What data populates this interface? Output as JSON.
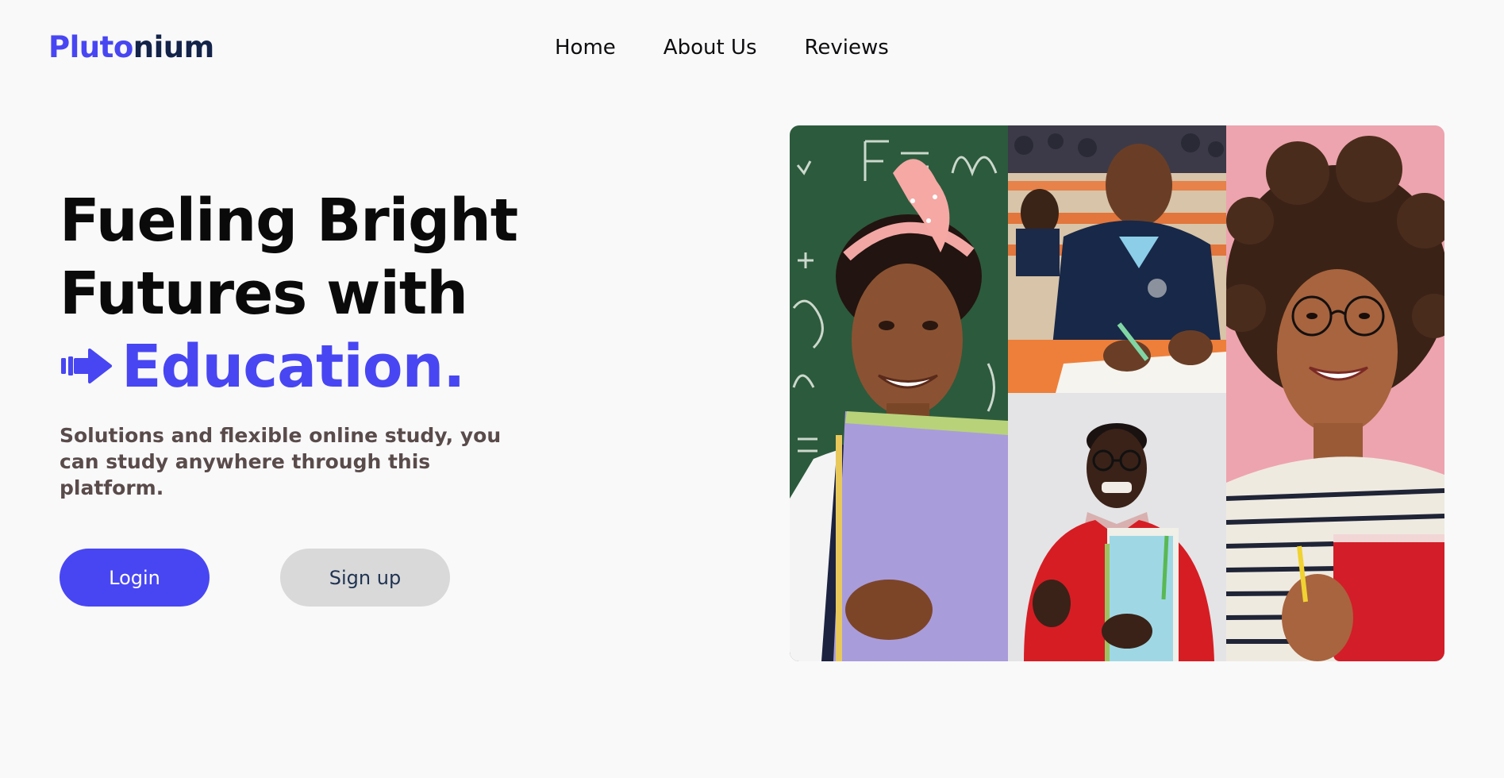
{
  "header": {
    "logo_part1": "Pluto",
    "logo_part2": "nium",
    "nav": [
      {
        "label": "Home"
      },
      {
        "label": "About Us"
      },
      {
        "label": "Reviews"
      }
    ]
  },
  "hero": {
    "headline_line1": "Fueling Bright",
    "headline_line2": "Futures with",
    "headline_accent": "Education.",
    "subtext": "Solutions and flexible online study, you can study anywhere through this platform.",
    "login_label": "Login",
    "signup_label": "Sign up",
    "accent_icon": "arrow-right-icon"
  },
  "collage": {
    "photos": [
      {
        "icon": "girl-with-folder-photo"
      },
      {
        "icon": "boy-writing-photo"
      },
      {
        "icon": "man-with-books-photo"
      },
      {
        "icon": "woman-with-glasses-photo"
      }
    ]
  },
  "colors": {
    "accent": "#4846f2",
    "logo_dark": "#13234a",
    "background": "#f9f9fa",
    "signup_bg": "#d9d9d9",
    "subtext": "#5a4b4b"
  }
}
